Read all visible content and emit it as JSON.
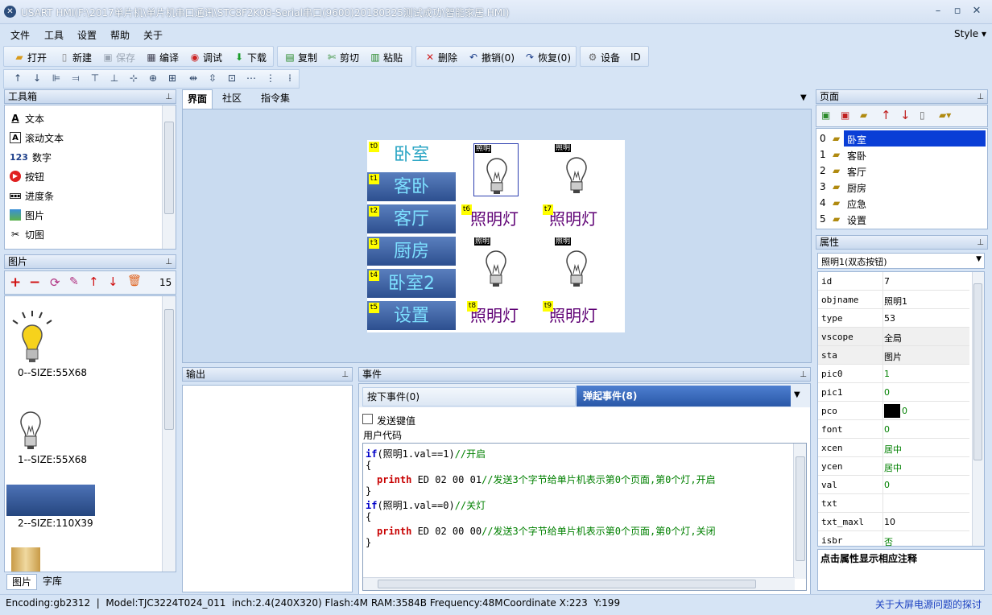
{
  "title": "USART HMI(F:\\2017单片机\\单片机串口通讯\\STC8F2K08-Serial串口(9600)20180325测试成功\\智能家居.HMI)",
  "menu": {
    "file": "文件",
    "tools": "工具",
    "settings": "设置",
    "help": "帮助",
    "about": "关于",
    "style": "Style"
  },
  "toolbar": {
    "open": "打开",
    "new": "新建",
    "save": "保存",
    "compile": "编译",
    "debug": "调试",
    "download": "下载",
    "copy": "复制",
    "cut": "剪切",
    "paste": "粘贴",
    "delete": "删除",
    "undo": "撤销(0)",
    "redo": "恢复(0)",
    "device": "设备",
    "id": "ID"
  },
  "toolbox": {
    "title": "工具箱",
    "items": [
      "文本",
      "滚动文本",
      "数字",
      "按钮",
      "进度条",
      "图片",
      "切图"
    ]
  },
  "pictures": {
    "title": "图片",
    "count": "15",
    "items": [
      "0--SIZE:55X68",
      "1--SIZE:55X68",
      "2--SIZE:110X39"
    ],
    "tab_pictures": "图片",
    "tab_fonts": "字库"
  },
  "center_tabs": {
    "ui": "界面",
    "community": "社区",
    "commands": "指令集"
  },
  "canvas": {
    "rooms": [
      "卧室",
      "客卧",
      "客厅",
      "厨房",
      "卧室2",
      "设置"
    ],
    "room_tags": [
      "t0",
      "t1",
      "t2",
      "t3",
      "t4",
      "t5"
    ],
    "lamp_text": "照明灯",
    "lamp_tags": [
      "t6",
      "t7",
      "t8",
      "t9"
    ],
    "mini_label": "照明"
  },
  "output": {
    "title": "输出"
  },
  "events": {
    "title": "事件",
    "tab_press": "按下事件(0)",
    "tab_release": "弹起事件(8)",
    "send_key": "发送键值",
    "user_code": "用户代码",
    "code": [
      {
        "kw": "if",
        "rest": "(照明1.val==1)",
        "cm": "//开启"
      },
      {
        "plain": "{"
      },
      {
        "fn": "printh",
        "rest": " ED 02 00 01",
        "cm": "//发送3个字节给单片机表示第0个页面,第0个灯,开启"
      },
      {
        "plain": "}"
      },
      {
        "kw": "if",
        "rest": "(照明1.val==0)",
        "cm": "//关灯"
      },
      {
        "plain": "{"
      },
      {
        "fn": "printh",
        "rest": " ED 02 00 00",
        "cm": "//发送3个字节给单片机表示第0个页面,第0个灯,关闭"
      },
      {
        "plain": "}"
      }
    ]
  },
  "pages": {
    "title": "页面",
    "items": [
      {
        "idx": "0",
        "name": "卧室"
      },
      {
        "idx": "1",
        "name": "客卧"
      },
      {
        "idx": "2",
        "name": "客厅"
      },
      {
        "idx": "3",
        "name": "厨房"
      },
      {
        "idx": "4",
        "name": "应急"
      },
      {
        "idx": "5",
        "name": "设置"
      }
    ]
  },
  "properties": {
    "title": "属性",
    "selected": "照明1(双态按钮)",
    "hint": "点击属性显示相应注释",
    "rows": [
      {
        "k": "id",
        "v": "7",
        "c": "#000"
      },
      {
        "k": "objname",
        "v": "照明1",
        "c": "#000"
      },
      {
        "k": "type",
        "v": "53",
        "c": "#000"
      },
      {
        "k": "vscope",
        "v": "全局",
        "c": "#000"
      },
      {
        "k": "sta",
        "v": "图片",
        "c": "#000"
      },
      {
        "k": "pic0",
        "v": "1",
        "c": "#008000"
      },
      {
        "k": "pic1",
        "v": "0",
        "c": "#008000"
      },
      {
        "k": "pco",
        "v": "0",
        "c": "#008000"
      },
      {
        "k": "font",
        "v": "0",
        "c": "#008000"
      },
      {
        "k": "xcen",
        "v": "居中",
        "c": "#008000"
      },
      {
        "k": "ycen",
        "v": "居中",
        "c": "#008000"
      },
      {
        "k": "val",
        "v": "0",
        "c": "#008000"
      },
      {
        "k": "txt",
        "v": "",
        "c": "#008000"
      },
      {
        "k": "txt_maxl",
        "v": "10",
        "c": "#000"
      },
      {
        "k": "isbr",
        "v": "否",
        "c": "#008000"
      }
    ]
  },
  "status": {
    "info": "Encoding:gb2312  |  Model:TJC3224T024_011  inch:2.4(240X320) Flash:4M RAM:3584B Frequency:48M",
    "coord": "Coordinate X:223  Y:199",
    "link": "关于大屏电源问题的探讨"
  }
}
